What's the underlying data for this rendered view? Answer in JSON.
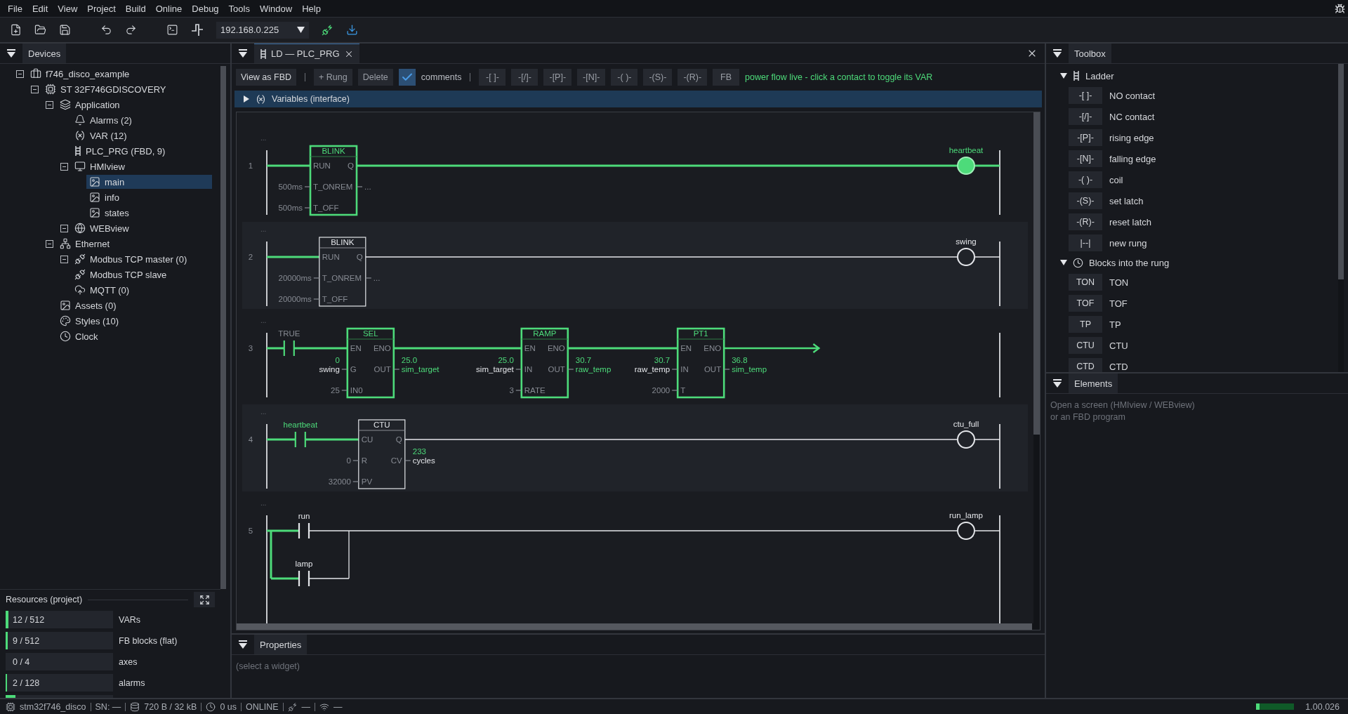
{
  "menu": [
    "File",
    "Edit",
    "View",
    "Project",
    "Build",
    "Online",
    "Debug",
    "Tools",
    "Window",
    "Help"
  ],
  "toolbar": {
    "address": "192.168.0.225"
  },
  "devices": {
    "title": "Devices",
    "tree": [
      {
        "kind": "project",
        "label": "f746_disco_example",
        "expanded": true,
        "selected": false,
        "children": [
          {
            "kind": "board",
            "label": "ST 32F746GDISCOVERY",
            "expanded": true,
            "selected": false,
            "children": [
              {
                "kind": "application",
                "label": "Application",
                "expanded": true,
                "selected": false,
                "children": [
                  {
                    "kind": "alarms",
                    "label": "Alarms (2)",
                    "selected": false
                  },
                  {
                    "kind": "variables",
                    "label": "VAR (12)",
                    "selected": false
                  },
                  {
                    "kind": "program",
                    "label": "PLC_PRG (FBD, 9)",
                    "selected": false
                  },
                  {
                    "kind": "hmi",
                    "label": "HMIview",
                    "expanded": true,
                    "selected": false,
                    "children": [
                      {
                        "kind": "screen",
                        "label": "main",
                        "selected": true
                      },
                      {
                        "kind": "screen",
                        "label": "info",
                        "selected": false
                      },
                      {
                        "kind": "screen",
                        "label": "states",
                        "selected": false
                      }
                    ]
                  },
                  {
                    "kind": "web",
                    "label": "WEBview",
                    "expanded": true,
                    "selected": false
                  }
                ]
              },
              {
                "kind": "ethernet",
                "label": "Ethernet",
                "expanded": true,
                "selected": false,
                "children": [
                  {
                    "kind": "modbus",
                    "label": "Modbus TCP master (0)",
                    "expanded": true,
                    "selected": false
                  },
                  {
                    "kind": "modbus",
                    "label": "Modbus TCP slave",
                    "selected": false
                  },
                  {
                    "kind": "cloud",
                    "label": "MQTT (0)",
                    "selected": false
                  }
                ]
              },
              {
                "kind": "screen",
                "label": "Assets (0)",
                "selected": false
              },
              {
                "kind": "styles",
                "label": "Styles (10)",
                "selected": false
              },
              {
                "kind": "clock",
                "label": "Clock",
                "selected": false
              }
            ]
          }
        ]
      }
    ]
  },
  "resources": {
    "title": "Resources (project)",
    "items": [
      {
        "value": "12 / 512",
        "label": "VARs",
        "level": 0.023
      },
      {
        "value": "9 / 512",
        "label": "FB blocks (flat)",
        "level": 0.018
      },
      {
        "value": "0 / 4",
        "label": "axes"
      },
      {
        "value": "2 / 128",
        "label": "alarms",
        "level": 0.016
      },
      {
        "level": 0.09
      }
    ]
  },
  "editor": {
    "tab": "LD — PLC_PRG",
    "toolbar": {
      "view_button": "View as FBD",
      "actions": [
        "+ Rung",
        "Delete"
      ],
      "comments": {
        "label": "comments",
        "checked": true
      },
      "snippets": [
        "-[ ]-",
        "-[/]-",
        "-[P]-",
        "-[N]-",
        "-( )-",
        "-(S)-",
        "-(R)-",
        "FB"
      ],
      "status": "power flow live - click a contact to toggle its VAR"
    },
    "variables": {
      "label": "Variables (interface)",
      "expanded": false
    },
    "rungs": [
      {
        "number": "1",
        "comment": "...",
        "elements": [
          {
            "kind": "block",
            "name": "BLINK",
            "energized": true,
            "rows": [
              {
                "in_pin": "RUN",
                "out_pin": "Q"
              },
              {
                "in_const": "500ms",
                "in_pin": "T_ONREM",
                "out_const": "..."
              },
              {
                "in_const": "500ms",
                "in_pin": "T_OFF"
              }
            ]
          },
          {
            "kind": "coil",
            "label": "heartbeat",
            "energized": true
          }
        ]
      },
      {
        "number": "2",
        "comment": "...",
        "elements": [
          {
            "kind": "block",
            "name": "BLINK",
            "energized": false,
            "rows": [
              {
                "in_pin": "RUN",
                "out_pin": "Q"
              },
              {
                "in_const": "20000ms",
                "in_pin": "T_ONREM",
                "out_const": "..."
              },
              {
                "in_const": "20000ms",
                "in_pin": "T_OFF"
              }
            ]
          },
          {
            "kind": "coil",
            "label": "swing",
            "energized": false
          }
        ]
      },
      {
        "number": "3",
        "comment": "...",
        "elements": [
          {
            "kind": "contact",
            "label": "TRUE",
            "constant": true,
            "energized": true
          },
          {
            "kind": "block",
            "name": "SEL",
            "energized": true,
            "rows": [
              {
                "in_pin": "EN",
                "out_pin": "ENO"
              },
              {
                "in_live": "0",
                "in_var": "swing",
                "in_pin": "G",
                "out_pin": "OUT",
                "out_live": "25.0",
                "out_var": "sim_target"
              },
              {
                "in_const": "25",
                "in_pin": "IN0"
              }
            ]
          },
          {
            "kind": "block",
            "name": "RAMP",
            "energized": true,
            "rows": [
              {
                "in_pin": "EN",
                "out_pin": "ENO"
              },
              {
                "in_live": "25.0",
                "in_var": "sim_target",
                "in_pin": "IN",
                "out_pin": "OUT",
                "out_live": "30.7",
                "out_var": "raw_temp"
              },
              {
                "in_const": "3",
                "in_pin": "RATE"
              }
            ]
          },
          {
            "kind": "block",
            "name": "PT1",
            "energized": true,
            "rows": [
              {
                "in_pin": "EN",
                "out_pin": "ENO"
              },
              {
                "in_live": "30.7",
                "in_var": "raw_temp",
                "in_pin": "IN",
                "out_pin": "OUT",
                "out_live": "36.8",
                "out_var": "sim_temp"
              },
              {
                "in_const": "2000",
                "in_pin": "T"
              }
            ]
          },
          {
            "kind": "arrow",
            "energized": true
          }
        ]
      },
      {
        "number": "4",
        "comment": "...",
        "elements": [
          {
            "kind": "contact",
            "label": "heartbeat",
            "constant": false,
            "energized": true
          },
          {
            "kind": "block",
            "name": "CTU",
            "energized": false,
            "rows": [
              {
                "in_pin": "CU",
                "out_pin": "Q"
              },
              {
                "in_const": "0",
                "in_pin": "R",
                "out_pin": "CV",
                "out_live": "233",
                "out_var": "cycles"
              },
              {
                "in_const": "32000",
                "in_pin": "PV"
              }
            ]
          },
          {
            "kind": "coil",
            "label": "ctu_full",
            "energized": false
          }
        ]
      },
      {
        "number": "5",
        "comment": "...",
        "elements": [
          {
            "kind": "parallel",
            "branches": [
              {
                "label": "run",
                "energized": false
              },
              {
                "label": "lamp",
                "energized": false
              }
            ]
          },
          {
            "kind": "coil",
            "label": "run_lamp",
            "energized": false
          }
        ]
      }
    ]
  },
  "properties": {
    "title": "Properties",
    "hint": "(select a widget)"
  },
  "toolbox": {
    "title": "Toolbox",
    "groups": [
      {
        "kind": "ladder",
        "label": "Ladder",
        "expanded": true,
        "items": [
          {
            "symbol": "-[ ]-",
            "label": "NO contact"
          },
          {
            "symbol": "-[/]-",
            "label": "NC contact"
          },
          {
            "symbol": "-[P]-",
            "label": "rising edge"
          },
          {
            "symbol": "-[N]-",
            "label": "falling edge"
          },
          {
            "symbol": "-( )-",
            "label": "coil"
          },
          {
            "symbol": "-(S)-",
            "label": "set latch"
          },
          {
            "symbol": "-(R)-",
            "label": "reset latch"
          },
          {
            "symbol": "|--|",
            "label": "new rung"
          }
        ]
      },
      {
        "kind": "blocks",
        "label": "Blocks into the rung",
        "expanded": true,
        "items": [
          {
            "symbol": "TON",
            "label": "TON"
          },
          {
            "symbol": "TOF",
            "label": "TOF"
          },
          {
            "symbol": "TP",
            "label": "TP"
          },
          {
            "symbol": "CTU",
            "label": "CTU"
          },
          {
            "symbol": "CTD",
            "label": "CTD"
          }
        ]
      }
    ]
  },
  "elements": {
    "title": "Elements",
    "hint": "Open a screen (HMIview / WEBview)\nor an FBD program"
  },
  "status_bar": {
    "items": [
      {
        "kind": "chip",
        "text": "stm32f746_disco"
      },
      {
        "kind": "text",
        "text": "SN: —"
      },
      {
        "kind": "database",
        "text": "720 B / 32 kB"
      },
      {
        "kind": "clock",
        "text": "0 us"
      },
      {
        "kind": "text",
        "text": "ONLINE"
      },
      {
        "kind": "plug",
        "text": "—"
      },
      {
        "kind": "wifi",
        "text": "—"
      }
    ],
    "progress": {
      "level": 0.08
    },
    "version": "1.00.026"
  }
}
